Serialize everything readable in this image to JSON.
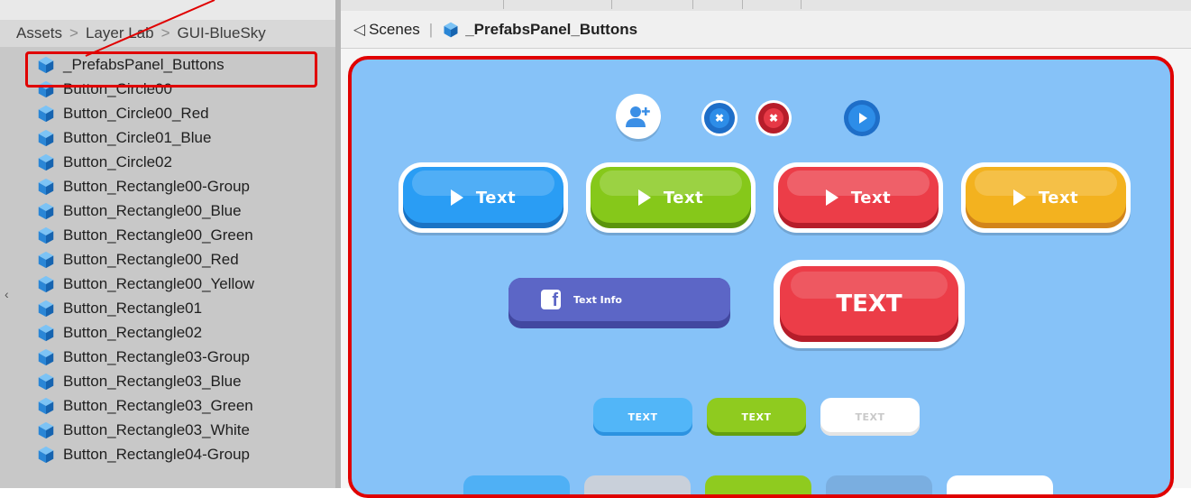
{
  "project": {
    "breadcrumb": [
      "Assets",
      "Layer Lab",
      "GUI-BlueSky"
    ],
    "items": [
      "_PrefabsPanel_Buttons",
      "Button_Circle00",
      "Button_Circle00_Red",
      "Button_Circle01_Blue",
      "Button_Circle02",
      "Button_Rectangle00-Group",
      "Button_Rectangle00_Blue",
      "Button_Rectangle00_Green",
      "Button_Rectangle00_Red",
      "Button_Rectangle00_Yellow",
      "Button_Rectangle01",
      "Button_Rectangle02",
      "Button_Rectangle03-Group",
      "Button_Rectangle03_Blue",
      "Button_Rectangle03_Green",
      "Button_Rectangle03_White",
      "Button_Rectangle04-Group"
    ],
    "selected_index": 0
  },
  "scene": {
    "header_label": "Scenes",
    "title": "_PrefabsPanel_Buttons"
  },
  "preview": {
    "big_buttons": [
      "Text",
      "Text",
      "Text",
      "Text"
    ],
    "facebook_label": "Text Info",
    "large_red_label": "TEXT",
    "small_buttons": [
      "TEXT",
      "TEXT",
      "TEXT"
    ]
  },
  "colors": {
    "highlight": "#e00000",
    "canvas_bg": "#86c2f8",
    "blue": "#2a9df4",
    "green": "#86c81a",
    "red": "#ec3d48",
    "yellow": "#f3b21f",
    "facebook": "#5861c0",
    "unity_cube": "#2a86d6"
  },
  "icons": [
    "unity-cube-icon",
    "scene-back-icon",
    "add-user-icon",
    "close-icon",
    "play-icon",
    "facebook-icon"
  ]
}
